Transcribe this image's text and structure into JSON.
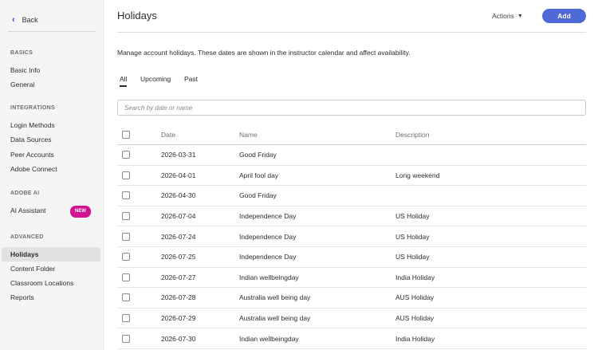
{
  "sidebar": {
    "back_label": "Back",
    "sections": [
      {
        "title": "BASICS",
        "items": [
          "Basic Info",
          "General"
        ]
      },
      {
        "title": "INTEGRATIONS",
        "items": [
          "Login Methods",
          "Data Sources",
          "Peer Accounts",
          "Adobe Connect"
        ]
      },
      {
        "title": "ADOBE AI",
        "items": [
          "AI Assistant"
        ]
      },
      {
        "title": "ADVANCED",
        "items": [
          "Holidays",
          "Content Folder",
          "Classroom Locations",
          "Reports"
        ]
      }
    ],
    "new_badge": "NEW",
    "active_item": "Holidays"
  },
  "header": {
    "title": "Holidays",
    "actions_label": "Actions",
    "add_label": "Add"
  },
  "description": "Manage account holidays. These dates are shown in the instructor calendar and affect availability.",
  "tabs": [
    {
      "label": "All",
      "active": true
    },
    {
      "label": "Upcoming",
      "active": false
    },
    {
      "label": "Past",
      "active": false
    }
  ],
  "search": {
    "placeholder": "Search by date or name"
  },
  "table": {
    "columns": [
      "Date",
      "Name",
      "Description"
    ],
    "rows": [
      {
        "date": "2026-03-31",
        "name": "Good Friday",
        "description": ""
      },
      {
        "date": "2026-04-01",
        "name": "April fool day",
        "description": "Long weekend"
      },
      {
        "date": "2026-04-30",
        "name": "Good Friday",
        "description": ""
      },
      {
        "date": "2026-07-04",
        "name": "Independence Day",
        "description": "US Holiday"
      },
      {
        "date": "2026-07-24",
        "name": "Independence Day",
        "description": "US Holiday"
      },
      {
        "date": "2026-07-25",
        "name": "Independence Day",
        "description": "US Holiday"
      },
      {
        "date": "2026-07-27",
        "name": "Indian wellbeingday",
        "description": "India Holiday"
      },
      {
        "date": "2026-07-28",
        "name": "Australia well being day",
        "description": "AUS Holiday"
      },
      {
        "date": "2026-07-29",
        "name": "Australia well being day",
        "description": "AUS Holiday"
      },
      {
        "date": "2026-07-30",
        "name": "Indian wellbeingday",
        "description": "India Holiday"
      }
    ]
  },
  "colors": {
    "accent": "#4f6ad7",
    "back_chevron": "#5b2fd6",
    "new_badge": "#d1118f",
    "sidebar_bg": "#f5f5f5",
    "active_item_bg": "#e1e1e1"
  }
}
